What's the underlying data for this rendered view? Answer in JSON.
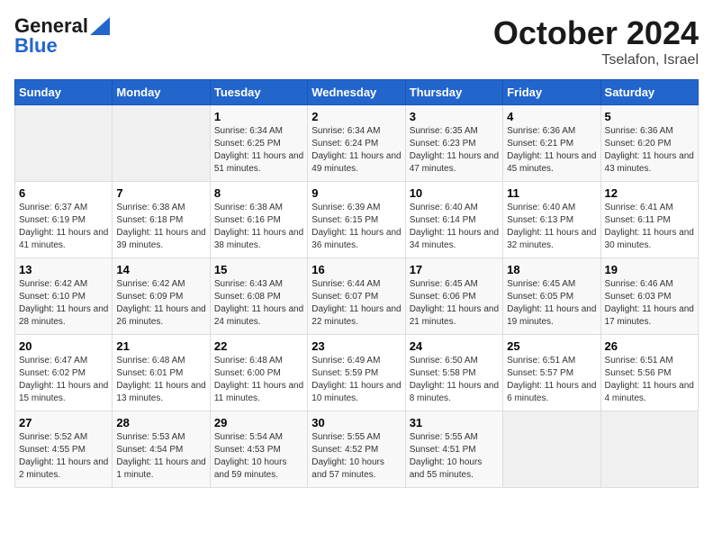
{
  "header": {
    "logo_line1": "General",
    "logo_line2": "Blue",
    "month": "October 2024",
    "location": "Tselafon, Israel"
  },
  "days_of_week": [
    "Sunday",
    "Monday",
    "Tuesday",
    "Wednesday",
    "Thursday",
    "Friday",
    "Saturday"
  ],
  "weeks": [
    [
      {
        "day": "",
        "info": ""
      },
      {
        "day": "",
        "info": ""
      },
      {
        "day": "1",
        "info": "Sunrise: 6:34 AM\nSunset: 6:25 PM\nDaylight: 11 hours and 51 minutes."
      },
      {
        "day": "2",
        "info": "Sunrise: 6:34 AM\nSunset: 6:24 PM\nDaylight: 11 hours and 49 minutes."
      },
      {
        "day": "3",
        "info": "Sunrise: 6:35 AM\nSunset: 6:23 PM\nDaylight: 11 hours and 47 minutes."
      },
      {
        "day": "4",
        "info": "Sunrise: 6:36 AM\nSunset: 6:21 PM\nDaylight: 11 hours and 45 minutes."
      },
      {
        "day": "5",
        "info": "Sunrise: 6:36 AM\nSunset: 6:20 PM\nDaylight: 11 hours and 43 minutes."
      }
    ],
    [
      {
        "day": "6",
        "info": "Sunrise: 6:37 AM\nSunset: 6:19 PM\nDaylight: 11 hours and 41 minutes."
      },
      {
        "day": "7",
        "info": "Sunrise: 6:38 AM\nSunset: 6:18 PM\nDaylight: 11 hours and 39 minutes."
      },
      {
        "day": "8",
        "info": "Sunrise: 6:38 AM\nSunset: 6:16 PM\nDaylight: 11 hours and 38 minutes."
      },
      {
        "day": "9",
        "info": "Sunrise: 6:39 AM\nSunset: 6:15 PM\nDaylight: 11 hours and 36 minutes."
      },
      {
        "day": "10",
        "info": "Sunrise: 6:40 AM\nSunset: 6:14 PM\nDaylight: 11 hours and 34 minutes."
      },
      {
        "day": "11",
        "info": "Sunrise: 6:40 AM\nSunset: 6:13 PM\nDaylight: 11 hours and 32 minutes."
      },
      {
        "day": "12",
        "info": "Sunrise: 6:41 AM\nSunset: 6:11 PM\nDaylight: 11 hours and 30 minutes."
      }
    ],
    [
      {
        "day": "13",
        "info": "Sunrise: 6:42 AM\nSunset: 6:10 PM\nDaylight: 11 hours and 28 minutes."
      },
      {
        "day": "14",
        "info": "Sunrise: 6:42 AM\nSunset: 6:09 PM\nDaylight: 11 hours and 26 minutes."
      },
      {
        "day": "15",
        "info": "Sunrise: 6:43 AM\nSunset: 6:08 PM\nDaylight: 11 hours and 24 minutes."
      },
      {
        "day": "16",
        "info": "Sunrise: 6:44 AM\nSunset: 6:07 PM\nDaylight: 11 hours and 22 minutes."
      },
      {
        "day": "17",
        "info": "Sunrise: 6:45 AM\nSunset: 6:06 PM\nDaylight: 11 hours and 21 minutes."
      },
      {
        "day": "18",
        "info": "Sunrise: 6:45 AM\nSunset: 6:05 PM\nDaylight: 11 hours and 19 minutes."
      },
      {
        "day": "19",
        "info": "Sunrise: 6:46 AM\nSunset: 6:03 PM\nDaylight: 11 hours and 17 minutes."
      }
    ],
    [
      {
        "day": "20",
        "info": "Sunrise: 6:47 AM\nSunset: 6:02 PM\nDaylight: 11 hours and 15 minutes."
      },
      {
        "day": "21",
        "info": "Sunrise: 6:48 AM\nSunset: 6:01 PM\nDaylight: 11 hours and 13 minutes."
      },
      {
        "day": "22",
        "info": "Sunrise: 6:48 AM\nSunset: 6:00 PM\nDaylight: 11 hours and 11 minutes."
      },
      {
        "day": "23",
        "info": "Sunrise: 6:49 AM\nSunset: 5:59 PM\nDaylight: 11 hours and 10 minutes."
      },
      {
        "day": "24",
        "info": "Sunrise: 6:50 AM\nSunset: 5:58 PM\nDaylight: 11 hours and 8 minutes."
      },
      {
        "day": "25",
        "info": "Sunrise: 6:51 AM\nSunset: 5:57 PM\nDaylight: 11 hours and 6 minutes."
      },
      {
        "day": "26",
        "info": "Sunrise: 6:51 AM\nSunset: 5:56 PM\nDaylight: 11 hours and 4 minutes."
      }
    ],
    [
      {
        "day": "27",
        "info": "Sunrise: 5:52 AM\nSunset: 4:55 PM\nDaylight: 11 hours and 2 minutes."
      },
      {
        "day": "28",
        "info": "Sunrise: 5:53 AM\nSunset: 4:54 PM\nDaylight: 11 hours and 1 minute."
      },
      {
        "day": "29",
        "info": "Sunrise: 5:54 AM\nSunset: 4:53 PM\nDaylight: 10 hours and 59 minutes."
      },
      {
        "day": "30",
        "info": "Sunrise: 5:55 AM\nSunset: 4:52 PM\nDaylight: 10 hours and 57 minutes."
      },
      {
        "day": "31",
        "info": "Sunrise: 5:55 AM\nSunset: 4:51 PM\nDaylight: 10 hours and 55 minutes."
      },
      {
        "day": "",
        "info": ""
      },
      {
        "day": "",
        "info": ""
      }
    ]
  ]
}
